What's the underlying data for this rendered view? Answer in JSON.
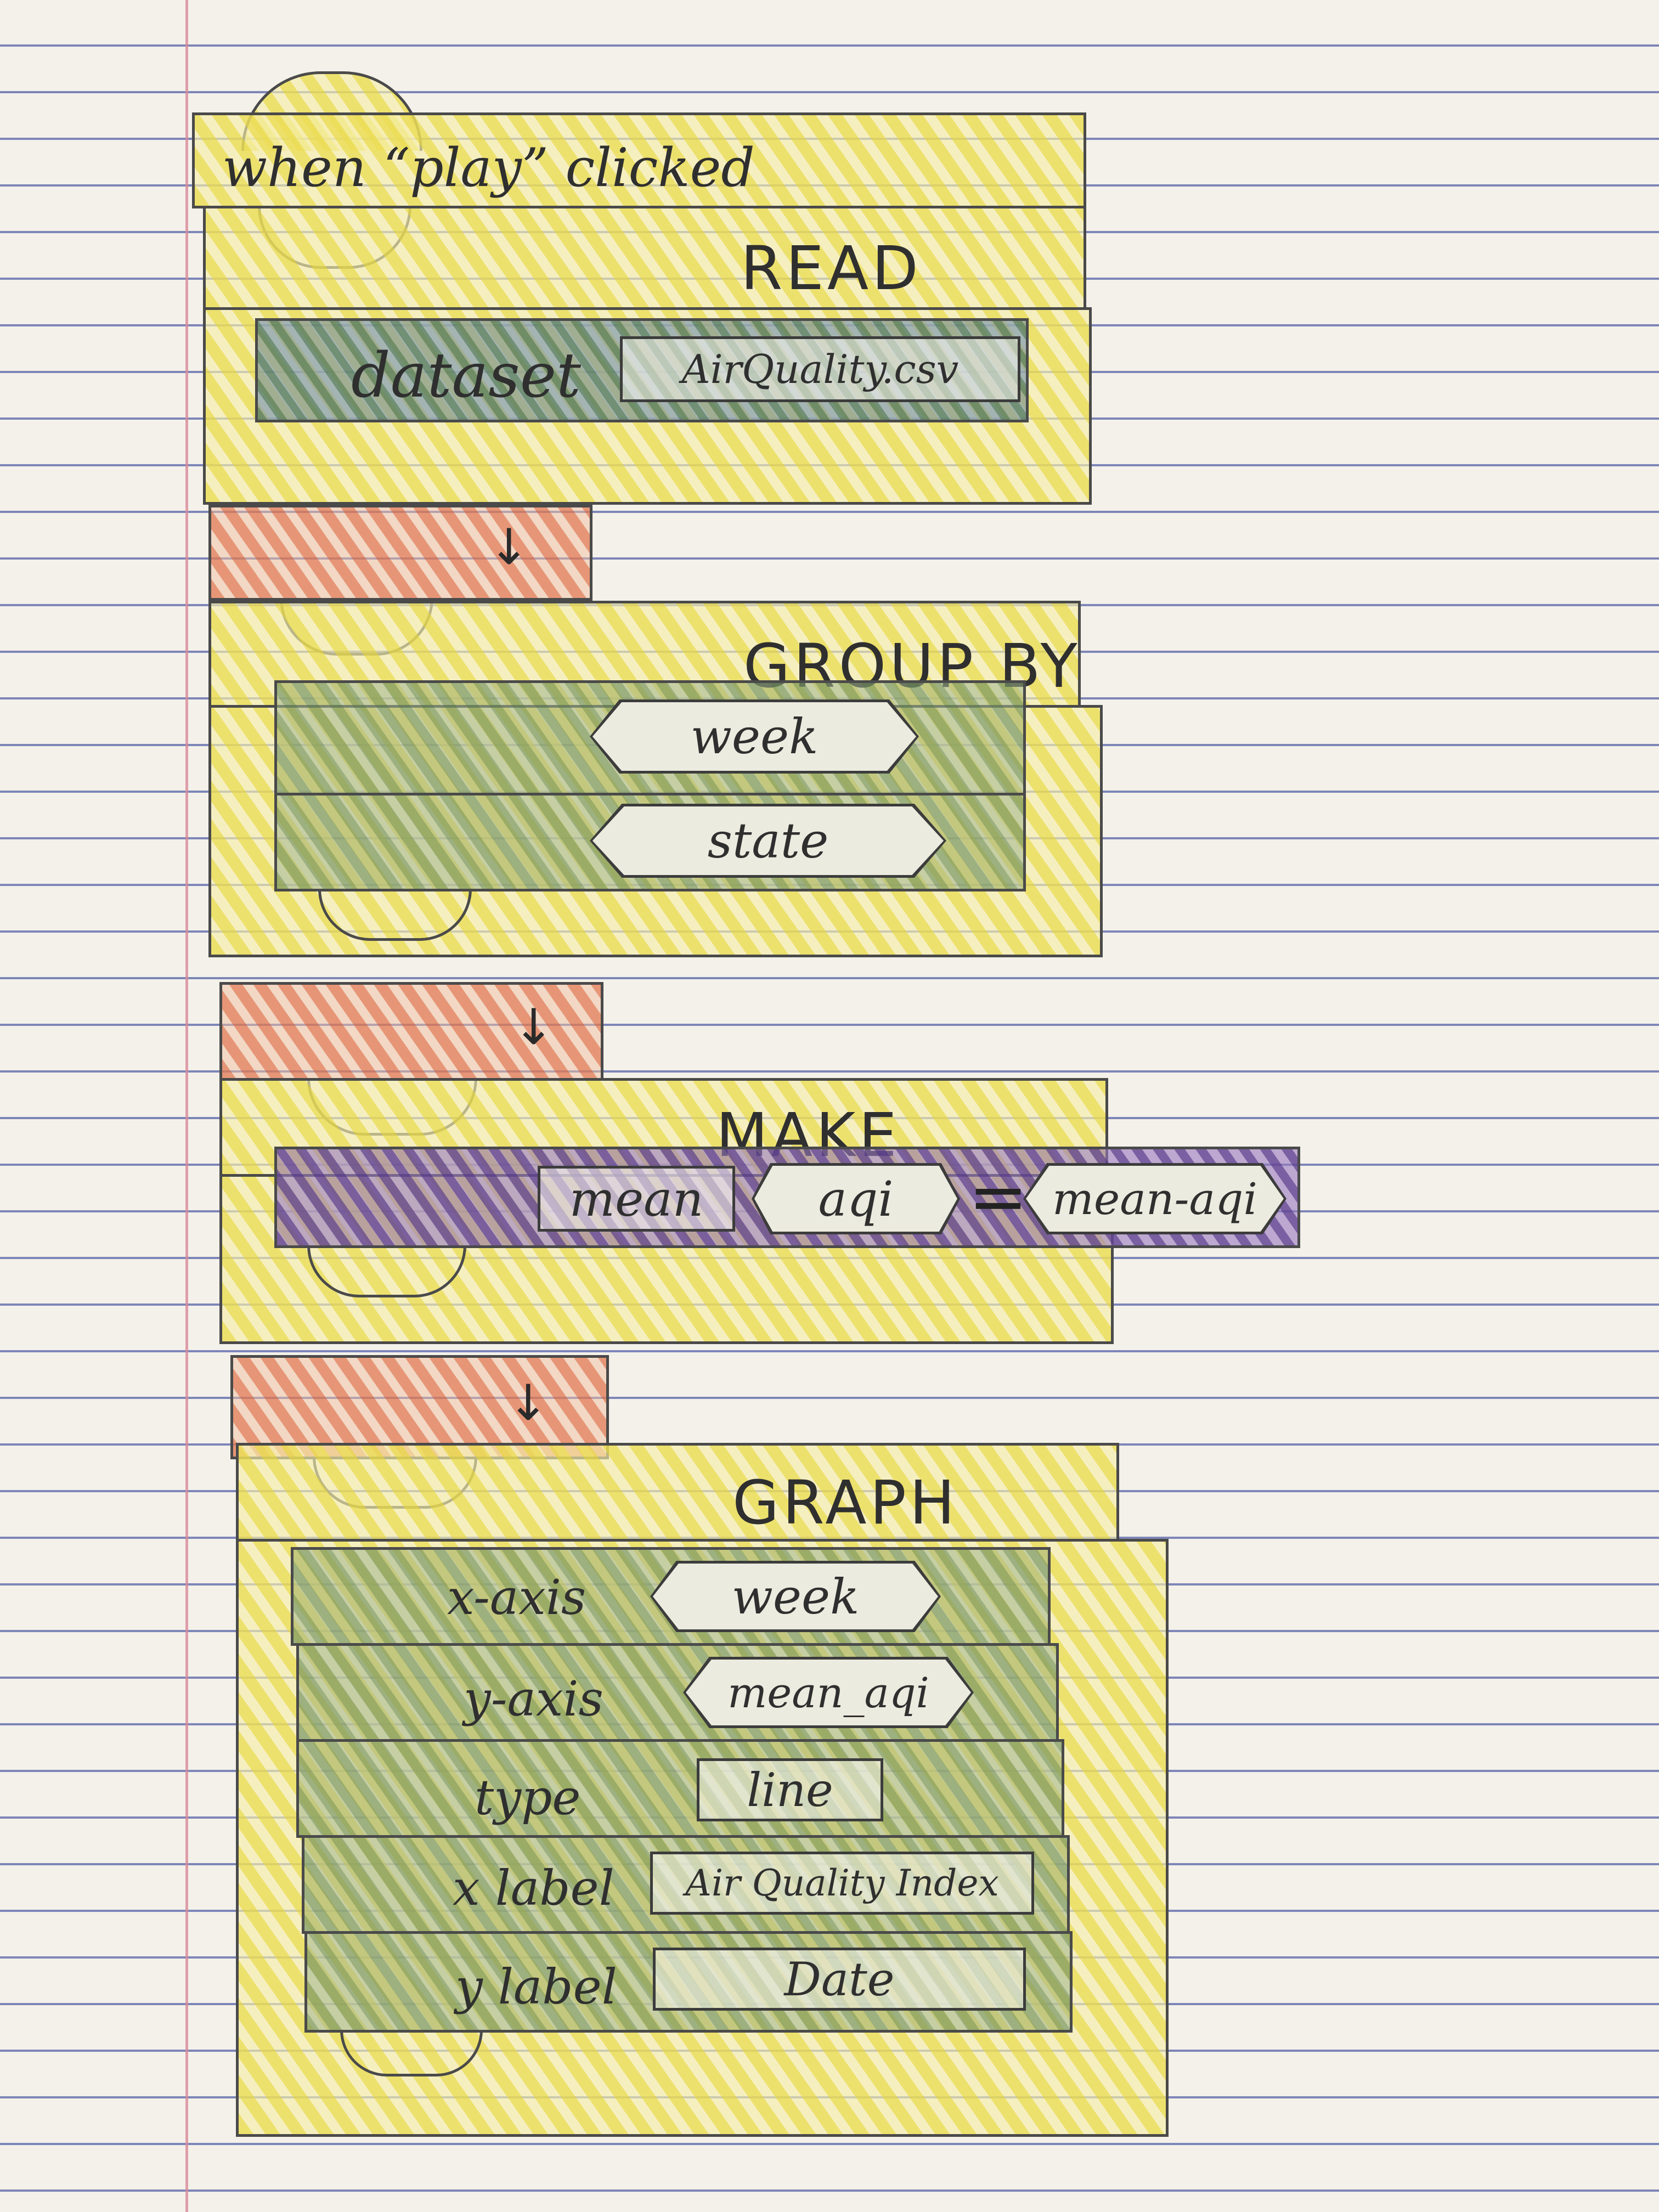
{
  "event": {
    "label": "when “play” clicked"
  },
  "read": {
    "heading": "READ",
    "dataset_label": "dataset",
    "dataset_value": "AirQuality.csv"
  },
  "group_by": {
    "heading": "GROUP BY",
    "fields": [
      "week",
      "state"
    ]
  },
  "make": {
    "heading": "MAKE",
    "function": "mean",
    "column": "aqi",
    "equals": "=",
    "result": "mean-aqi"
  },
  "graph": {
    "heading": "GRAPH",
    "x_axis_label": "x-axis",
    "x_axis_value": "week",
    "y_axis_label": "y-axis",
    "y_axis_value": "mean_aqi",
    "type_label": "type",
    "type_value": "line",
    "xlabel_label": "x label",
    "xlabel_value": "Air Quality Index",
    "ylabel_label": "y label",
    "ylabel_value": "Date"
  },
  "connector": {
    "arrow": "↓"
  },
  "colors": {
    "event_block": "#ecde58",
    "step_block": "#ecde58",
    "param_block": "#7896 64",
    "arrow_block": "#e27850",
    "make_param": "#644696",
    "outline": "#4a4a4a"
  }
}
